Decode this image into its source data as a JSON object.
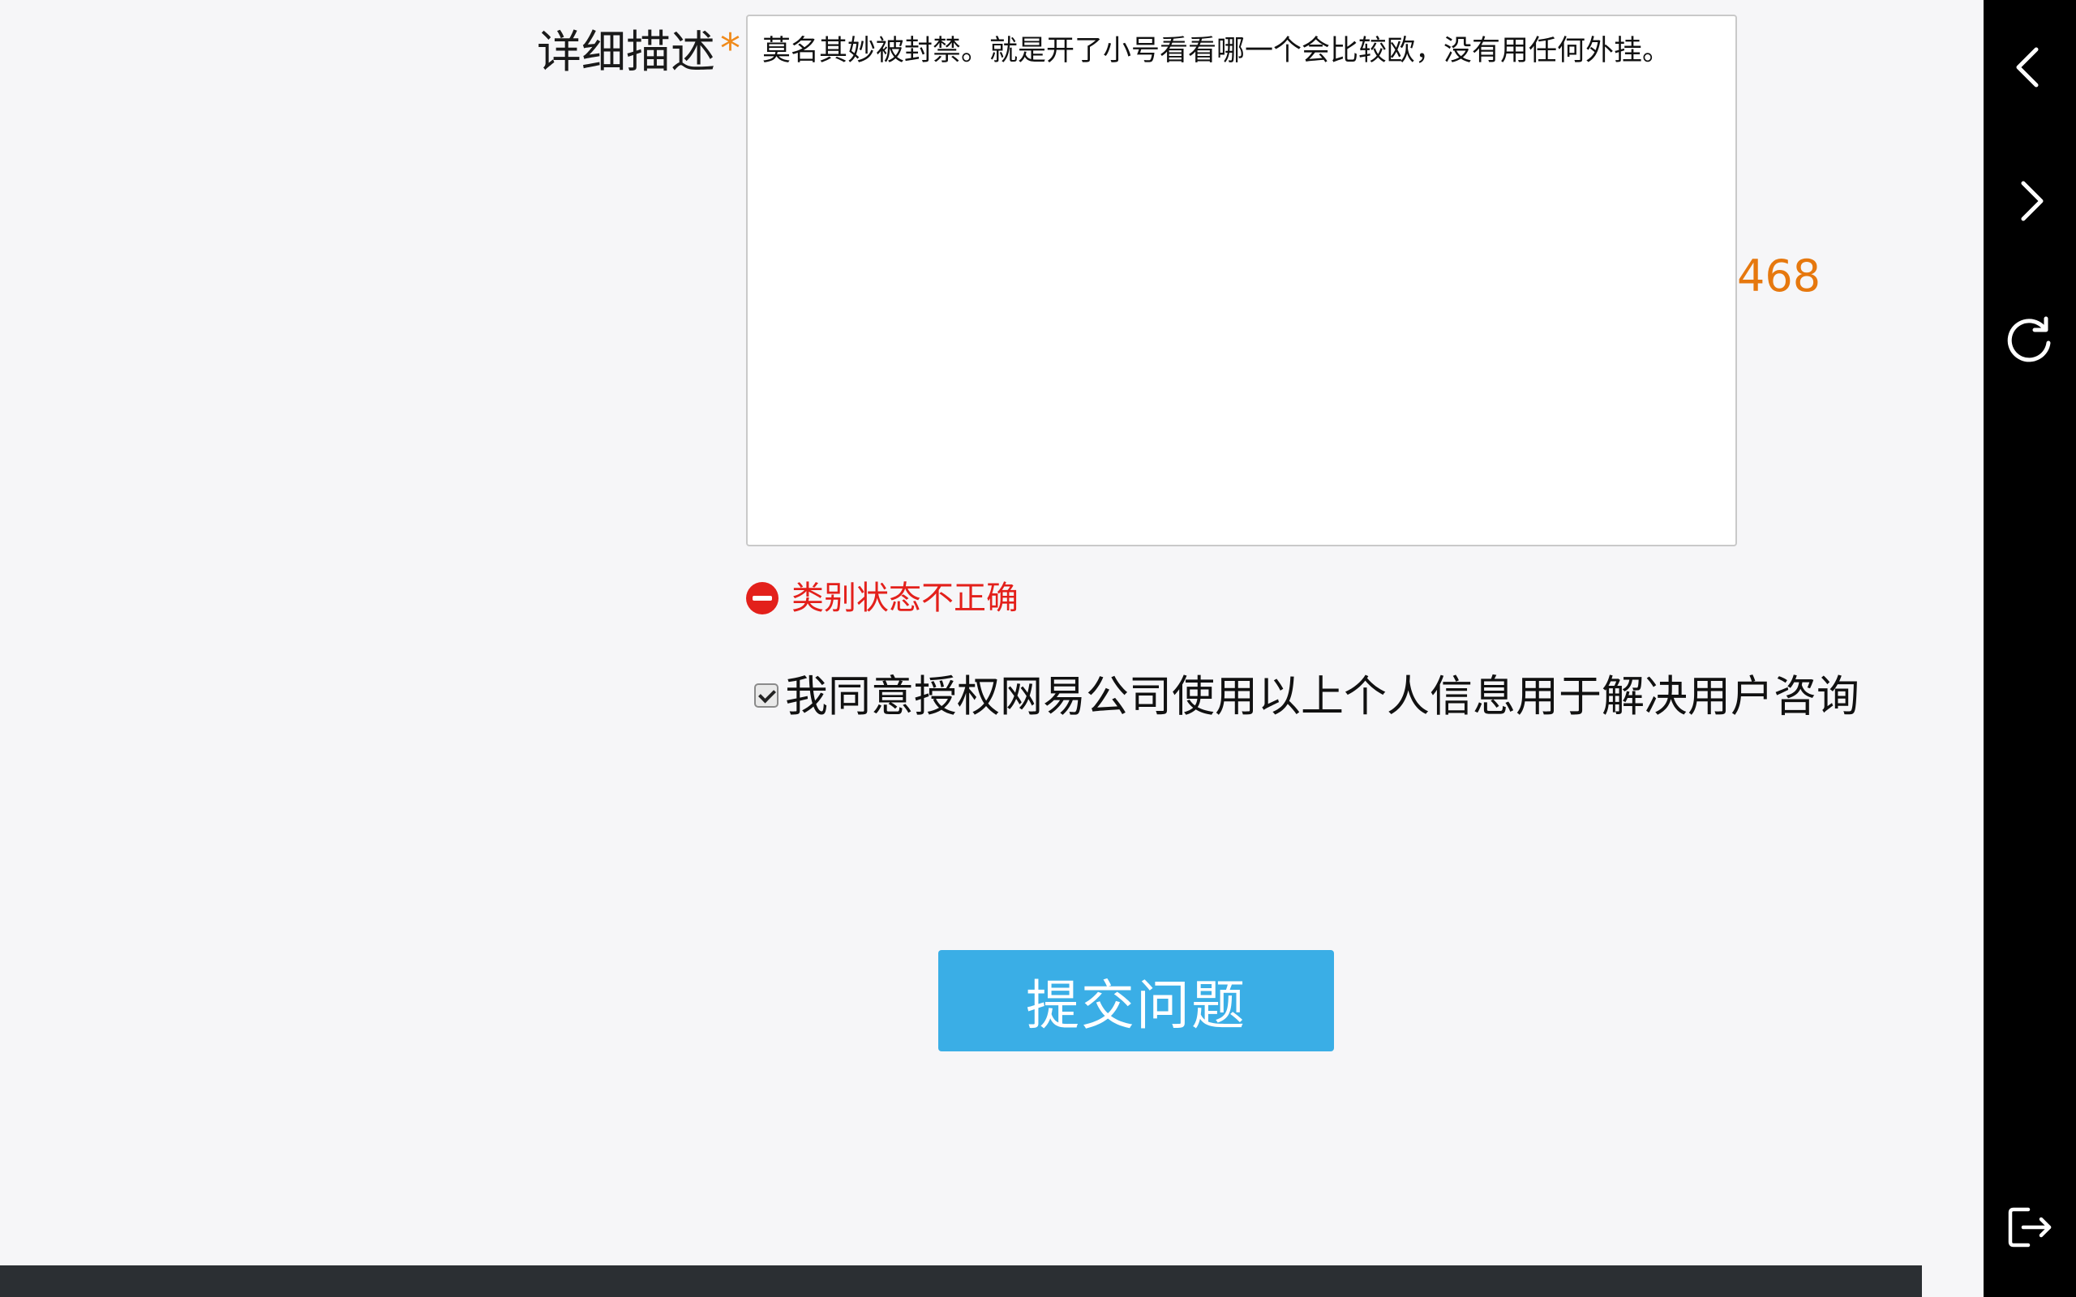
{
  "form": {
    "description_label": "详细描述",
    "required_mark": "*",
    "description_value": "莫名其妙被封禁。就是开了小号看看哪一个会比较欧，没有用任何外挂。",
    "char_count": "468",
    "error_message": "类别状态不正确",
    "consent_label": "我同意授权网易公司使用以上个人信息用于解决用户咨询",
    "consent_checked": true,
    "submit_label": "提交问题"
  },
  "side_rail": {
    "buttons": [
      {
        "icon": "chevron-left-icon"
      },
      {
        "icon": "chevron-right-icon"
      },
      {
        "icon": "refresh-icon"
      },
      {
        "icon": "exit-icon"
      }
    ]
  },
  "colors": {
    "background": "#f6f6f8",
    "accent": "#3aaee6",
    "error": "#e3201b",
    "counter": "#e6780e",
    "required": "#f08a1a",
    "rail": "#000000",
    "footer": "#2b2f33"
  }
}
